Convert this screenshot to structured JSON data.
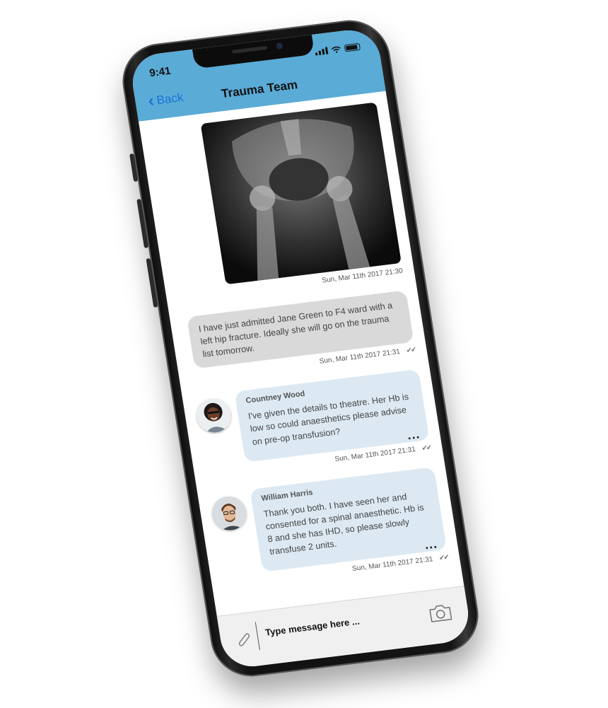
{
  "status_bar": {
    "time": "9:41"
  },
  "nav": {
    "back_label": "Back",
    "title": "Trauma Team"
  },
  "messages": [
    {
      "type": "image",
      "timestamp": "Sun, Mar 11th 2017 21:30"
    },
    {
      "type": "outgoing",
      "text": "I have just admitted Jane Green to F4 ward with a left hip fracture. Ideally she will go on the trauma list tomorrow.",
      "timestamp": "Sun, Mar 11th 2017 21:31",
      "ticks": "✔✔"
    },
    {
      "type": "incoming",
      "sender": "Countney Wood",
      "text": "I've given the details to theatre. Her Hb is low so could anaesthetics please advise on pre-op transfusion?",
      "timestamp": "Sun, Mar 11th 2017 21:31",
      "ticks": "✔✔",
      "more": "..."
    },
    {
      "type": "incoming",
      "sender": "William Harris",
      "text": "Thank you both. I have seen her and consented for a spinal anaesthetic. Hb is 8 and she has IHD, so please slowly transfuse 2 units.",
      "timestamp": "Sun, Mar 11th 2017 21:31",
      "ticks": "✔✔",
      "more": "..."
    }
  ],
  "composer": {
    "placeholder": "Type message here ..."
  },
  "colors": {
    "header": "#5aabd6",
    "incoming_bubble": "#dce9f3",
    "outgoing_bubble": "#d9d9d9",
    "back_link": "#1a73d9"
  }
}
